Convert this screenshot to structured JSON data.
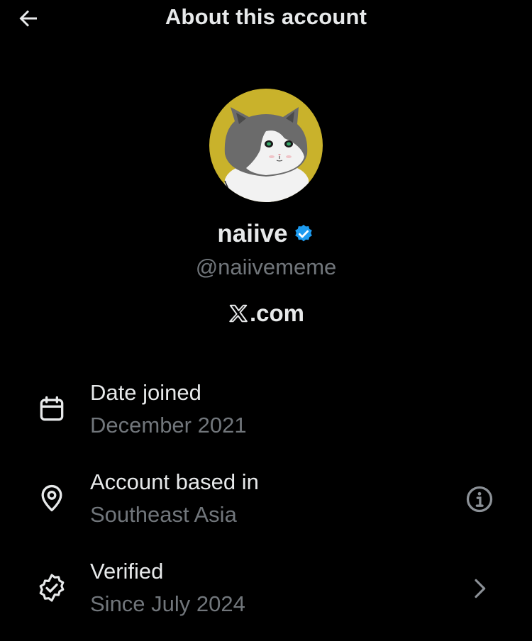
{
  "header": {
    "title": "About this account",
    "back_icon": "arrow-left-icon"
  },
  "profile": {
    "avatar_description": "pixel-art-cat-avatar",
    "display_name": "naiive",
    "verified_icon": "verified-badge-icon",
    "handle": "@naiivememe",
    "domain_suffix": ".com",
    "domain_icon": "x-logo-icon"
  },
  "rows": [
    {
      "icon": "calendar-icon",
      "label": "Date joined",
      "value": "December 2021"
    },
    {
      "icon": "location-pin-icon",
      "label": "Account based in",
      "value": "Southeast Asia",
      "trailing_icon": "info-icon"
    },
    {
      "icon": "verified-seal-icon",
      "label": "Verified",
      "value": "Since July 2024",
      "trailing_icon": "chevron-right-icon"
    }
  ],
  "colors": {
    "background": "#000000",
    "primary_text": "#e7e9ea",
    "secondary_text": "#71767b",
    "verified_blue": "#1d9bf0",
    "avatar_bg": "#c9b22b"
  }
}
